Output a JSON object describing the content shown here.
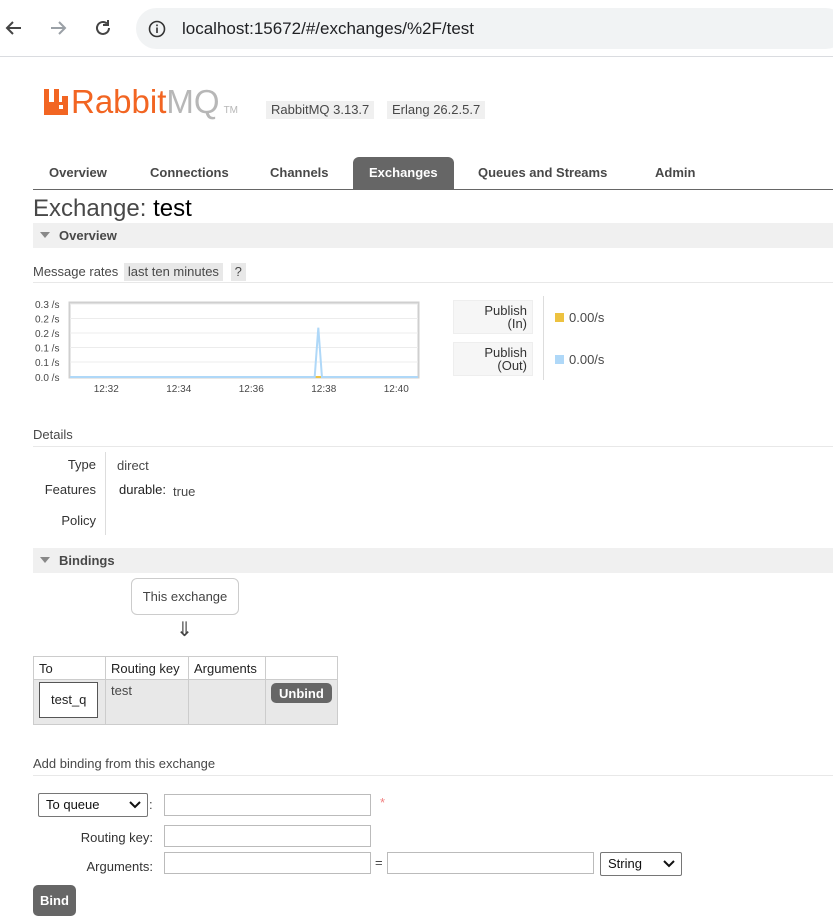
{
  "browser": {
    "url": "localhost:15672/#/exchanges/%2F/test"
  },
  "header": {
    "logo_primary": "Rabbit",
    "logo_secondary": "MQ",
    "logo_tm": "TM",
    "version_rabbitmq": "RabbitMQ 3.13.7",
    "version_erlang": "Erlang 26.2.5.7"
  },
  "tabs": [
    {
      "label": "Overview",
      "active": false
    },
    {
      "label": "Connections",
      "active": false
    },
    {
      "label": "Channels",
      "active": false
    },
    {
      "label": "Exchanges",
      "active": true
    },
    {
      "label": "Queues and Streams",
      "active": false
    },
    {
      "label": "Admin",
      "active": false
    }
  ],
  "page": {
    "title_prefix": "Exchange:",
    "title_name": "test"
  },
  "overview": {
    "section_label": "Overview",
    "message_rates_label": "Message rates",
    "range_label": "last ten minutes",
    "help_label": "?"
  },
  "chart_data": {
    "type": "line",
    "y_tick_labels": [
      "0.3 /s",
      "0.2 /s",
      "0.2 /s",
      "0.1 /s",
      "0.1 /s",
      "0.0 /s"
    ],
    "x_tick_labels": [
      "12:32",
      "12:34",
      "12:36",
      "12:38",
      "12:40"
    ],
    "ylim": [
      0,
      0.3
    ],
    "series": [
      {
        "name": "Publish (In)",
        "color": "#edc240",
        "points": [
          [
            0,
            0
          ],
          [
            9.6,
            0
          ]
        ]
      },
      {
        "name": "Publish (Out)",
        "color": "#afd8f8",
        "points": [
          [
            0,
            0
          ],
          [
            6.75,
            0
          ],
          [
            6.85,
            0.2
          ],
          [
            6.95,
            0
          ],
          [
            9.6,
            0
          ]
        ]
      }
    ]
  },
  "legend": [
    {
      "line1": "Publish",
      "line2": "(In)",
      "value": "0.00/s",
      "color": "#edc240"
    },
    {
      "line1": "Publish",
      "line2": "(Out)",
      "value": "0.00/s",
      "color": "#afd8f8"
    }
  ],
  "details": {
    "heading": "Details",
    "type_label": "Type",
    "type_value": "direct",
    "features_label": "Features",
    "durable_key": "durable:",
    "durable_value": "true",
    "policy_label": "Policy"
  },
  "bindings": {
    "section_label": "Bindings",
    "this_exchange": "This exchange",
    "arrow": "⇓",
    "columns": [
      "To",
      "Routing key",
      "Arguments",
      ""
    ],
    "rows": [
      {
        "to": "test_q",
        "routing_key": "test",
        "arguments": "",
        "action": "Unbind"
      }
    ]
  },
  "add_binding": {
    "heading": "Add binding from this exchange",
    "destination_type": "To queue",
    "colon": ":",
    "required_mark": "*",
    "routing_key_label": "Routing key:",
    "arguments_label": "Arguments:",
    "equals": "=",
    "arg_type": "String",
    "submit_label": "Bind"
  }
}
